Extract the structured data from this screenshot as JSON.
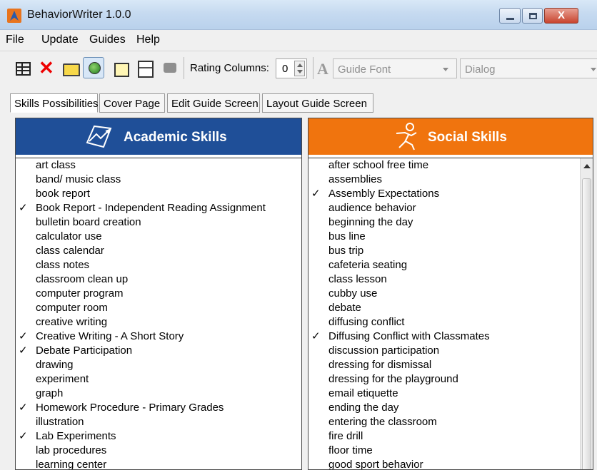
{
  "window": {
    "title": "BehaviorWriter 1.0.0",
    "close_label": "X"
  },
  "menu": [
    "File",
    "Update",
    "Guides",
    "Help"
  ],
  "toolbar": {
    "rating_label": "Rating Columns:",
    "rating_value": "0",
    "font_icon": "A",
    "guide_font_placeholder": "Guide Font",
    "dialog_value": "Dialog",
    "icons": [
      "table-icon",
      "delete-icon",
      "open-folder-icon",
      "refresh-icon",
      "folder-icon",
      "save-icon",
      "print-icon"
    ]
  },
  "tabs": [
    "Skills Possibilities",
    "Cover Page",
    "Edit Guide Screen",
    "Layout Guide Screen"
  ],
  "academic": {
    "title": "Academic Skills",
    "items": [
      {
        "label": "art class",
        "mark": ""
      },
      {
        "label": "band/ music class",
        "mark": ""
      },
      {
        "label": "book report",
        "mark": ""
      },
      {
        "label": "Book Report - Independent Reading Assignment",
        "mark": "✓"
      },
      {
        "label": "bulletin board creation",
        "mark": ""
      },
      {
        "label": "calculator use",
        "mark": ""
      },
      {
        "label": "class calendar",
        "mark": ""
      },
      {
        "label": "class notes",
        "mark": ""
      },
      {
        "label": "classroom clean up",
        "mark": ""
      },
      {
        "label": "computer program",
        "mark": ""
      },
      {
        "label": "computer room",
        "mark": ""
      },
      {
        "label": "creative writing",
        "mark": ""
      },
      {
        "label": "Creative Writing - A Short Story",
        "mark": "✓"
      },
      {
        "label": "Debate Participation",
        "mark": "✓"
      },
      {
        "label": "drawing",
        "mark": ""
      },
      {
        "label": "experiment",
        "mark": ""
      },
      {
        "label": "graph",
        "mark": ""
      },
      {
        "label": "Homework Procedure - Primary Grades",
        "mark": "✓"
      },
      {
        "label": "illustration",
        "mark": ""
      },
      {
        "label": "Lab Experiments",
        "mark": "✓"
      },
      {
        "label": "lab procedures",
        "mark": ""
      },
      {
        "label": "learning center",
        "mark": ""
      }
    ]
  },
  "social": {
    "title": "Social Skills",
    "items": [
      {
        "label": "after school free time",
        "mark": ""
      },
      {
        "label": "assemblies",
        "mark": ""
      },
      {
        "label": "Assembly Expectations",
        "mark": "✓"
      },
      {
        "label": "audience behavior",
        "mark": ""
      },
      {
        "label": "beginning the day",
        "mark": ""
      },
      {
        "label": "bus line",
        "mark": ""
      },
      {
        "label": "bus trip",
        "mark": ""
      },
      {
        "label": "cafeteria seating",
        "mark": ""
      },
      {
        "label": "class lesson",
        "mark": ""
      },
      {
        "label": "cubby use",
        "mark": ""
      },
      {
        "label": "debate",
        "mark": ""
      },
      {
        "label": "diffusing conflict",
        "mark": ""
      },
      {
        "label": "Diffusing Conflict with Classmates",
        "mark": "✓"
      },
      {
        "label": "discussion participation",
        "mark": ""
      },
      {
        "label": "dressing for dismissal",
        "mark": ""
      },
      {
        "label": "dressing for the playground",
        "mark": ""
      },
      {
        "label": "email etiquette",
        "mark": ""
      },
      {
        "label": "ending the day",
        "mark": ""
      },
      {
        "label": "entering the classroom",
        "mark": ""
      },
      {
        "label": "fire drill",
        "mark": ""
      },
      {
        "label": "floor time",
        "mark": ""
      },
      {
        "label": "good sport behavior",
        "mark": ""
      }
    ]
  },
  "colors": {
    "academic_header": "#1f4f98",
    "social_header": "#f0740e"
  }
}
